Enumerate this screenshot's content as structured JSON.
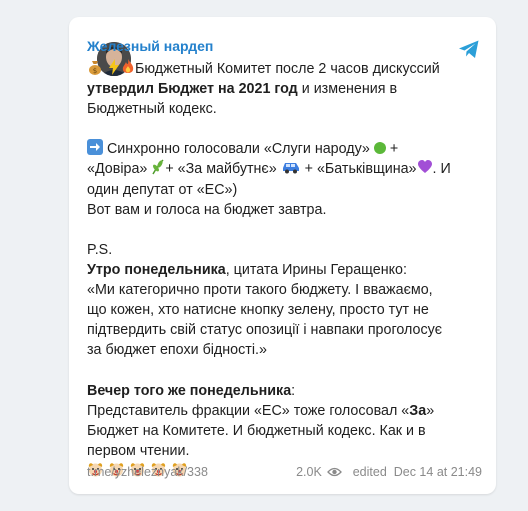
{
  "channel": {
    "name": "Железный нардеп"
  },
  "post": {
    "l1": "Бюджетный Комитет после 2 часов дискуссий",
    "l2_bold": "утвердил Бюджет на 2021 год",
    "l2_rest": " и изменения в",
    "l3": "Бюджетный кодекс.",
    "l5": "Синхронно голосовали «Слуги народу»",
    "l6a": "«Довіра»",
    "l6b": "+ «За майбутнє»",
    "l6c": " + «Батьківщина»",
    "l6d": ". И",
    "l7": "один депутат от «ЕС»)",
    "l8": "Вот вам и голоса на бюджет завтра.",
    "ps": "P.S.",
    "morning_bold": "Утро понедельника",
    "morning_rest": ", цитата Ирины Геращенко:",
    "q1": "«Ми категорично проти такого бюджету. І вважаємо,",
    "q2": "що кожен, хто натисне кнопку зелену, просто тут не",
    "q3": "підтвердить свій статус опозиції і навпаки проголосує",
    "q4": "за бюджет епохи бідності.»",
    "evening_bold": "Вечер того же понедельника",
    "evening_colon": ":",
    "e1": "Представитель фракции «ЕС» тоже голосовал «",
    "e1_bold": "За",
    "e1_end": "»",
    "e2": "Бюджет на Комитете. И бюджетный кодекс. Как и в",
    "e3": "первом чтении."
  },
  "footer": {
    "link": "t.me/yzheleznyak/338",
    "views": "2.0K",
    "edited": "edited",
    "date": "Dec 14 at 21:49"
  },
  "colors": {
    "accent": "#2481cc",
    "meta": "#8a8a8a"
  },
  "icons": [
    "avatar",
    "telegram-icon",
    "money-bag-icon",
    "zap-icon",
    "fire-icon",
    "right-arrow-icon",
    "green-circle-icon",
    "herb-icon",
    "car-icon",
    "purple-heart-icon",
    "clown-icon",
    "eye-icon"
  ]
}
